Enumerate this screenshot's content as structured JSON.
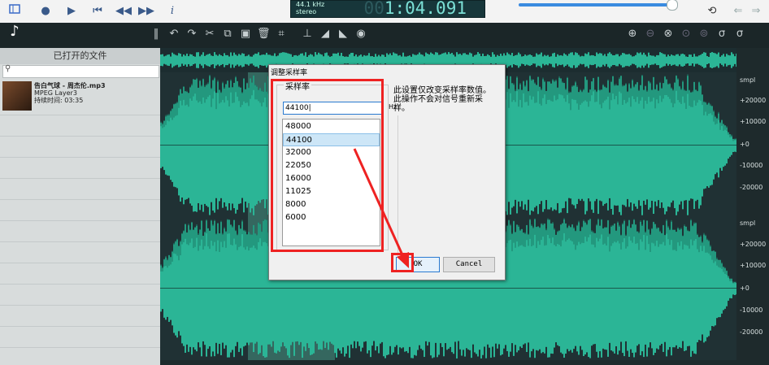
{
  "transport": {
    "sample_rate_line1": "44.1 kHz",
    "sample_rate_line2": "stereo",
    "time_ghost": "00",
    "time": "1:04.091",
    "info_button": "i"
  },
  "left_panel": {
    "title": "已打开的文件",
    "search_placeholder": "",
    "file": {
      "name": "告白气球 - 周杰伦.mp3",
      "format": "MPEG Layer3",
      "duration": "持续时间: 03:35"
    }
  },
  "scale": {
    "labels_top": [
      "smpl",
      "+20000",
      "+10000",
      "+0",
      "-10000",
      "-20000"
    ],
    "labels_bottom": [
      "smpl",
      "+20000",
      "+10000",
      "+0",
      "-10000",
      "-20000"
    ]
  },
  "dialog": {
    "title": "调整采样率",
    "group_label": "采样率",
    "input_value": "44100|",
    "unit": "Hz",
    "description": "此设置仅改变采样率数值。此操作不会对信号重新采样。",
    "rates": [
      "48000",
      "44100",
      "32000",
      "22050",
      "16000",
      "11025",
      "8000",
      "6000"
    ],
    "selected_rate": "44100",
    "ok_label": "OK",
    "cancel_label": "Cancel"
  },
  "colors": {
    "waveform": "#2bb596",
    "waveform_dark": "#1e7f6b",
    "selection": "#5fcdb3",
    "annotation": "#e22222",
    "accent": "#2a7ad0"
  }
}
